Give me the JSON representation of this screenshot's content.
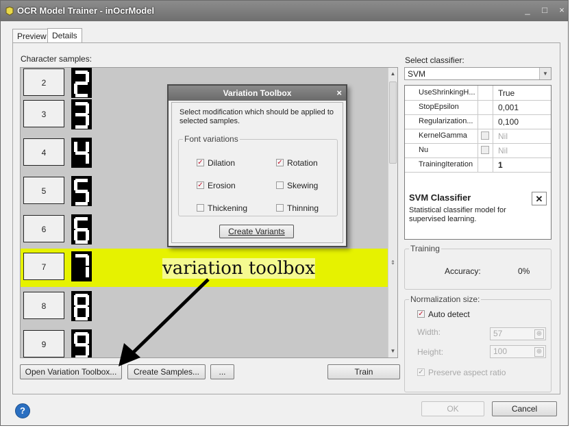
{
  "window": {
    "title": "OCR Model Trainer - inOcrModel",
    "controls": [
      "_",
      "□",
      "×"
    ]
  },
  "tabs": [
    {
      "label": "Preview"
    },
    {
      "label": "Details"
    }
  ],
  "samples": {
    "label": "Character samples:",
    "rows": [
      {
        "number": "2",
        "glyph": "2"
      },
      {
        "number": "3",
        "glyph": "3"
      },
      {
        "number": "4",
        "glyph": "4"
      },
      {
        "number": "5",
        "glyph": "5"
      },
      {
        "number": "6",
        "glyph": "6"
      },
      {
        "number": "7",
        "glyph": "7",
        "selected": true
      },
      {
        "number": "8",
        "glyph": "8"
      },
      {
        "number": "9",
        "glyph": "9"
      }
    ],
    "selected_color": "#e6f200"
  },
  "annotation": {
    "text": "variation toolbox"
  },
  "dialog": {
    "title": "Variation Toolbox",
    "close": "×",
    "instruction": "Select modification which should be applied to selected samples.",
    "group_label": "Font variations",
    "options": [
      {
        "label": "Dilation",
        "checked": true
      },
      {
        "label": "Rotation",
        "checked": true
      },
      {
        "label": "Erosion",
        "checked": true
      },
      {
        "label": "Skewing",
        "checked": false
      },
      {
        "label": "Thickening",
        "checked": false
      },
      {
        "label": "Thinning",
        "checked": false
      }
    ],
    "create_button": "Create Variants"
  },
  "buttons": {
    "open_toolbox": "Open Variation Toolbox...",
    "create_samples": "Create Samples...",
    "more": "...",
    "train": "Train",
    "ok": "OK",
    "cancel": "Cancel",
    "help": "?"
  },
  "classifier": {
    "label": "Select classifier:",
    "selected": "SVM",
    "properties": [
      {
        "name": "UseShrinkingH...",
        "value": "True",
        "has_button": false,
        "disabled": false
      },
      {
        "name": "StopEpsilon",
        "value": "0,001",
        "has_button": false,
        "disabled": false
      },
      {
        "name": "Regularization...",
        "value": "0,100",
        "has_button": false,
        "disabled": false
      },
      {
        "name": "KernelGamma",
        "value": "Nil",
        "has_button": true,
        "disabled": true
      },
      {
        "name": "Nu",
        "value": "Nil",
        "has_button": true,
        "disabled": true
      },
      {
        "name": "TrainingIteration",
        "value": "1",
        "has_button": false,
        "disabled": false,
        "bold": true
      }
    ],
    "description_title": "SVM Classifier",
    "description_text": "Statistical classifier model for supervised learning."
  },
  "training": {
    "group_label": "Training",
    "accuracy_label": "Accuracy:",
    "accuracy_value": "0%"
  },
  "normalization": {
    "group_label": "Normalization size:",
    "auto_detect_label": "Auto detect",
    "auto_detect_checked": true,
    "width_label": "Width:",
    "width_value": "57",
    "height_label": "Height:",
    "height_value": "100",
    "preserve_label": "Preserve aspect ratio",
    "preserve_checked": true
  }
}
